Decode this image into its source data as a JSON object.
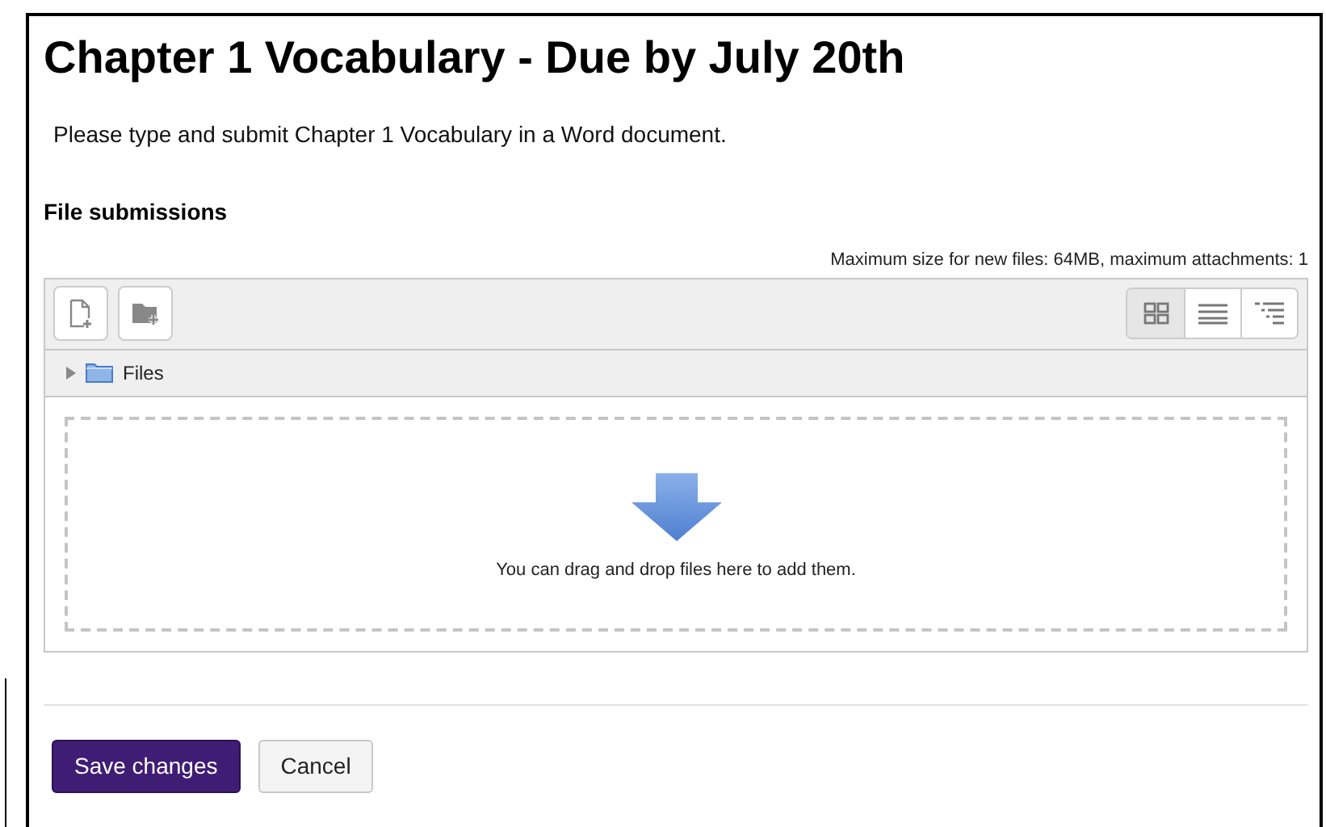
{
  "title": "Chapter 1 Vocabulary - Due by July 20th",
  "description": "Please type and submit Chapter 1 Vocabulary in a Word document.",
  "section_heading": "File submissions",
  "limits": "Maximum size for new files: 64MB, maximum attachments: 1",
  "view_modes": [
    {
      "kind": "icons",
      "selected": true
    },
    {
      "kind": "list",
      "selected": false
    },
    {
      "kind": "tree",
      "selected": false
    }
  ],
  "folder": {
    "label": "Files",
    "expanded": false
  },
  "drop_hint": "You can drag and drop files here to add them.",
  "buttons": [
    {
      "label": "Save changes",
      "kind": "primary"
    },
    {
      "label": "Cancel",
      "kind": "secondary"
    }
  ]
}
